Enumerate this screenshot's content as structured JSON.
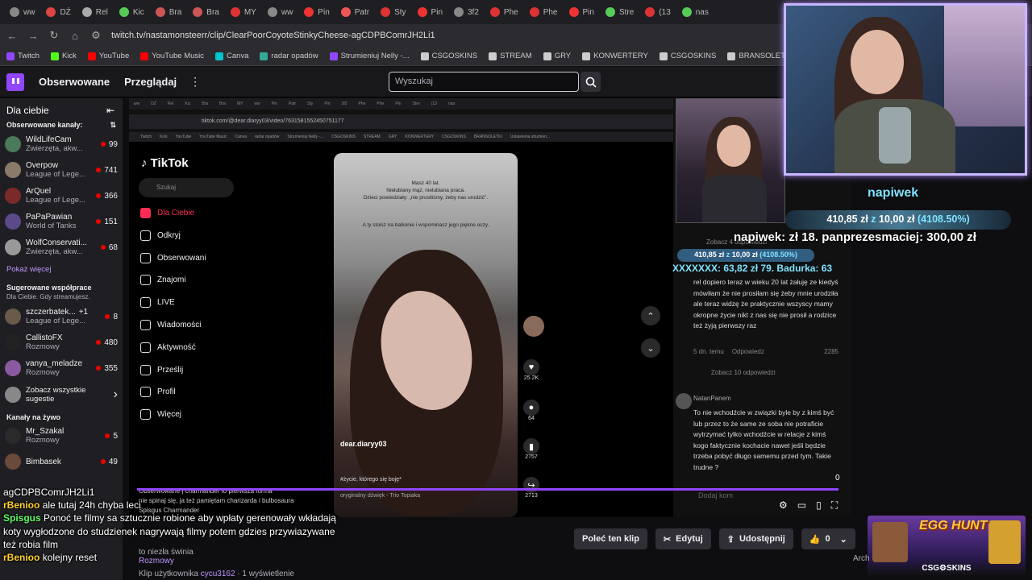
{
  "browser": {
    "tabs": [
      "ww",
      "DŹ",
      "Rel",
      "Kic",
      "Bra",
      "Bra",
      "MY",
      "ww",
      "Pin",
      "Patr",
      "Sty",
      "Pin",
      "3f2",
      "Phe",
      "Phe",
      "Pin",
      "Stre",
      "(13",
      "nas"
    ],
    "url": "twitch.tv/nastamonsteerr/clip/ClearPoorCoyoteStinkyCheese-agCDPBComrJH2Li1",
    "bookmarks": [
      "Twitch",
      "Kick",
      "YouTube",
      "YouTube Music",
      "Canva",
      "radar opadów",
      "Strumieniuj Nelly -...",
      "CSGOSKINS",
      "STREAM",
      "GRY",
      "KONWERTERY",
      "CSGOSKINS",
      "BRANSOLETKI",
      "Ustawienia strumien..."
    ]
  },
  "twitch": {
    "nav": {
      "following": "Obserwowane",
      "browse": "Przeglądaj"
    },
    "search_placeholder": "Wyszukaj"
  },
  "sidebar": {
    "title": "Dla ciebie",
    "followed_header": "Obserwowane kanały:",
    "channels": [
      {
        "name": "WildLifeCam",
        "game": "Zwierzęta, akw...",
        "viewers": "99",
        "color": "#4a7a5a"
      },
      {
        "name": "Overpow",
        "game": "League of Lege...",
        "viewers": "741",
        "color": "#8a7a6a"
      },
      {
        "name": "ArQuel",
        "game": "League of Lege...",
        "viewers": "366",
        "color": "#7a2a2a"
      },
      {
        "name": "PaPaPawian",
        "game": "World of Tanks",
        "viewers": "151",
        "color": "#5a4a8a"
      },
      {
        "name": "WolfConservati...",
        "game": "Zwierzęta, akw...",
        "viewers": "68",
        "color": "#999999"
      }
    ],
    "show_more": "Pokaż więcej",
    "collab_header": "Sugerowane współprace",
    "collab_sub": "Dla Ciebie. Gdy streamujesz.",
    "collabs": [
      {
        "name": "szczerbatek...",
        "extra": "+1",
        "game": "League of Lege...",
        "viewers": "8",
        "color": "#6a5a4a"
      },
      {
        "name": "CallistoFX",
        "game": "Rozmowy",
        "viewers": "480",
        "color": "#222222"
      },
      {
        "name": "vanya_meladze",
        "game": "Rozmowy",
        "viewers": "355",
        "color": "#8a5aa0"
      }
    ],
    "see_all": "Zobacz wszystkie sugestie",
    "live_header": "Kanały na żywo",
    "live": [
      {
        "name": "Mr_Szakal",
        "game": "Rozmowy",
        "viewers": "5",
        "color": "#2a2a2a"
      },
      {
        "name": "Bimbasek",
        "game": "",
        "viewers": "49",
        "color": "#6a4a3a"
      }
    ]
  },
  "tiktok": {
    "url": "tiktok.com/@dear.diaryy03/video/7631581552450751177",
    "search": "Szukaj",
    "nav": [
      "Dla Ciebie",
      "Odkryj",
      "Obserwowani",
      "Znajomi",
      "LIVE",
      "Wiadomości",
      "Aktywność",
      "Prześlij",
      "Profil",
      "Więcej"
    ],
    "clip_text1": "Masz 40 lat.\nNielubiany mąż, nielubiana praca.\nDzieci powiedziały: „nie prosiliśmy, żeby nas urodzić\".",
    "clip_text2": "A ty stoisz na balkonie i wspominasz jego piękne oczy.",
    "author": "dear.diaryy03",
    "caption": "#życie, którego się boję*",
    "sound": "oryginalny dźwięk - Trio Topiaka",
    "likes": "25.2K",
    "comments_count": "64",
    "saves": "2757",
    "shares": "2713",
    "comments": [
      {
        "user": "",
        "text": "rel dopiero teraz w wieku 20 lat żałuję ze kiedyś mówiłam że nie prosiłam się żeby mnie urodziła ale teraz widzę że praktycznie wszyscy mamy okropne życie nikt z nas się nie prosił a rodzice też żyją pierwszy raz",
        "meta": "5 dn. temu",
        "reply": "Odpowiedz",
        "likes": "2285"
      },
      {
        "user": "NatanPanem",
        "text": "To nie wchodźcie w związki byle by z kimś być lub przez to że same ze soba nie potraficie wytrzymać tylko wchodźcie w relacje z kimś kogo faktycznie kochacie nawet jeśli będzie trzeba pobyć długo samemu przed tym. Takie trudne ?",
        "meta": "",
        "reply": "",
        "likes": ""
      }
    ],
    "see_replies": "Zobacz 10 odpowiedzi",
    "see_replies_top": "Zobacz 4 odpowiedzi",
    "add_comment": "Dodaj kom",
    "chat_lines": [
      "Obserwowane | charmander to pierwsza forma",
      "nie spinaj się, ja też pamiętam charizarda i bulbosaura",
      "Spisgus Charmander",
      "Kasiulka ♥",
      "majkesel00 okrowa",
      "Heka"
    ]
  },
  "overlay": {
    "donor": "napiwek",
    "donation": "410,85 zł",
    "z": "z",
    "goal": "10,00 zł",
    "percent": "(4108.50%)",
    "ticker": "napiwek: zł 18. panprezesmaciej: 300,00 zł",
    "ticker_small": "XXXXXXX: 63,82 zł  79. Badurka: 63"
  },
  "stream_chat": [
    {
      "user": "",
      "text": "agCDPBComrJH2Li1"
    },
    {
      "user": "rBenioo",
      "text": "ale tutaj 24h chyba leci"
    },
    {
      "user": "Spisgus",
      "text": "Ponoć te filmy sa sztucznie robione aby wpłaty gerenowały wkładają koty wygłodzone do studzienek nagrywają filmy potem gdzies przywiazywane też robia film"
    },
    {
      "user": "rBenioo",
      "text": "kolejny reset"
    }
  ],
  "clip": {
    "actions": [
      "Poleć ten klip",
      "Edytuj",
      "Udostępnij",
      "0"
    ],
    "title_fragment": "to niezła świnia",
    "category": "Rozmowy",
    "author_label": "Klip użytkownika",
    "author": "cycu3162",
    "views": "· 1 wyświetlenie",
    "progress_zero": "0"
  },
  "promo": {
    "title": "EGG HUNT",
    "brand": "CSG⚙SKINS",
    "arch": "Arch"
  }
}
